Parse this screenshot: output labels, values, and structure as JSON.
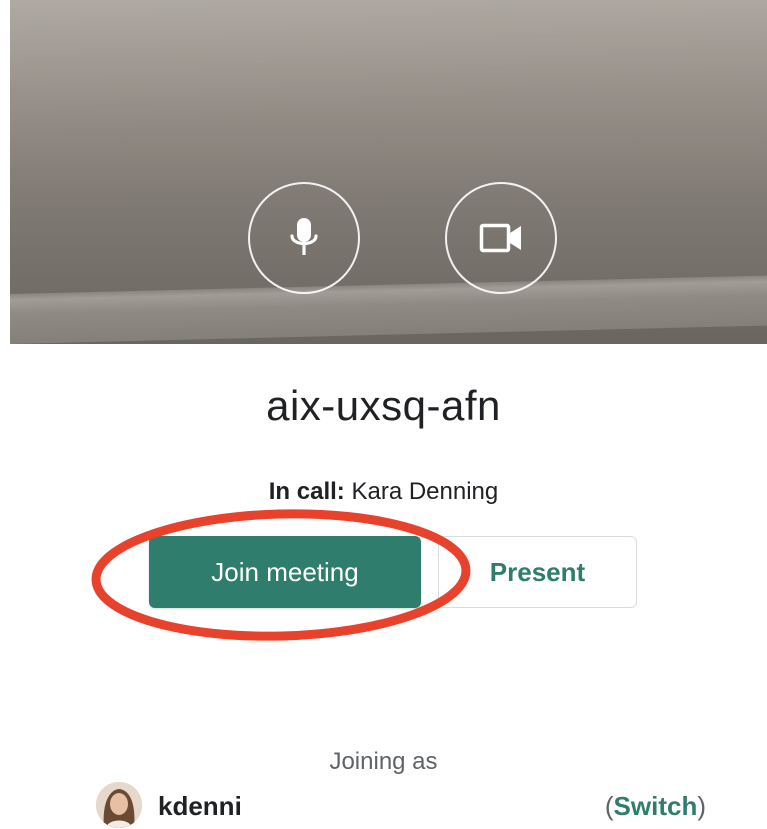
{
  "preview": {
    "controls": {
      "microphone": "microphone-icon",
      "camera": "video-camera-icon"
    }
  },
  "meeting": {
    "code": "aix-uxsq-afn",
    "in_call_label": "In call:",
    "in_call_names": "Kara Denning"
  },
  "actions": {
    "join_label": "Join meeting",
    "present_label": "Present"
  },
  "account": {
    "joining_as_label": "Joining as",
    "username": "kdenni",
    "switch_open": "(",
    "switch_label": "Switch",
    "switch_close": ")"
  },
  "colors": {
    "accent": "#2f7e6d",
    "annotation": "#e8412c"
  }
}
